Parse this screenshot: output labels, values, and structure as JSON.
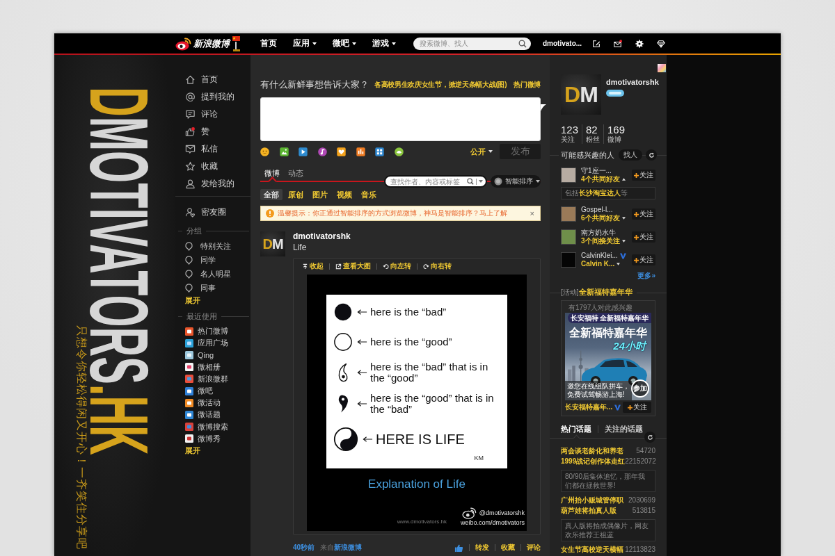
{
  "banner": {
    "logo_parts": [
      {
        "text": "D",
        "kind": "accent"
      },
      {
        "text": "MOTIVATORS",
        "kind": "plain"
      },
      {
        "text": ".HK",
        "kind": "accent"
      }
    ],
    "slogan": "只想令你轻松得闲又开心！一齐笑住分享吧"
  },
  "top_nav": {
    "logo_text": "新浪微博",
    "items": [
      {
        "label": "首页",
        "dropdown": false
      },
      {
        "label": "应用",
        "dropdown": true
      },
      {
        "label": "微吧",
        "dropdown": true
      },
      {
        "label": "游戏",
        "dropdown": true
      }
    ],
    "search": {
      "placeholder": "搜索微博、找人"
    },
    "username": "dmotivato...",
    "mail_unread": true
  },
  "left_nav": {
    "main_items": [
      {
        "label": "首页",
        "unread": false
      },
      {
        "label": "提到我的",
        "unread": false
      },
      {
        "label": "评论",
        "unread": false
      },
      {
        "label": "赞",
        "unread": true
      },
      {
        "label": "私信",
        "unread": false
      },
      {
        "label": "收藏",
        "unread": false
      },
      {
        "label": "发给我的",
        "unread": false
      }
    ],
    "circle_item": {
      "label": "密友圈"
    },
    "groups": {
      "title": "分组",
      "items": [
        {
          "label": "特别关注"
        },
        {
          "label": "同学"
        },
        {
          "label": "名人明星"
        },
        {
          "label": "同事"
        }
      ],
      "more": "展开"
    },
    "recent": {
      "title": "最近使用",
      "items": [
        {
          "label": "热门微博"
        },
        {
          "label": "应用广场"
        },
        {
          "label": "Qing"
        },
        {
          "label": "微相册"
        },
        {
          "label": "新浪微群"
        },
        {
          "label": "微吧"
        },
        {
          "label": "微活动"
        },
        {
          "label": "微话题"
        },
        {
          "label": "微博搜索"
        },
        {
          "label": "微博秀"
        }
      ],
      "more": "展开"
    }
  },
  "composer": {
    "prompt": "有什么新鲜事想告诉大家？",
    "hot_topic": "各高校男生欢庆女生节，掀逆天条幅大战(图)",
    "hot_label": "热门微博",
    "visibility": "公开",
    "submit": "发布"
  },
  "feed": {
    "tabs": [
      {
        "label": "微博",
        "selected": true
      },
      {
        "label": "动态",
        "selected": false
      }
    ],
    "search": {
      "placeholder": "查找作者、内容或标签"
    },
    "sort": "智能排序",
    "filters": [
      {
        "label": "全部",
        "selected": true
      },
      {
        "label": "原创",
        "selected": false
      },
      {
        "label": "图片",
        "selected": false
      },
      {
        "label": "视频",
        "selected": false
      },
      {
        "label": "音乐",
        "selected": false
      }
    ],
    "notice": {
      "text": "温馨提示：你正通过智能排序的方式浏览微博，神马是智能排序？马上了解",
      "close": "×"
    }
  },
  "post": {
    "avatar_text": "DM",
    "author": "dmotivatorshk",
    "text": "Life",
    "media": {
      "actions": [
        {
          "label": "收起"
        },
        {
          "label": "查看大图"
        },
        {
          "label": "向左转"
        },
        {
          "label": "向右转"
        }
      ],
      "card_lines": [
        {
          "kind": "dark",
          "text": "here is the “bad”"
        },
        {
          "kind": "light",
          "text": "here is the “good”"
        },
        {
          "kind": "lightdot",
          "text": "here is the “bad” that is in the “good”"
        },
        {
          "kind": "darkdot",
          "text": "here is the “good” that is in the “bad”"
        },
        {
          "kind": "yinyang",
          "text": "HERE IS LIFE"
        }
      ],
      "signature": "KM",
      "caption": "Explanation of Life",
      "site": "www.dmotivators.hk",
      "handle": "@dmotivatorshk",
      "url": "weibo.com/dmotivators"
    },
    "time": "40秒前",
    "source_prefix": "来自",
    "source": "新浪微博",
    "actions": [
      "转发",
      "收藏",
      "评论"
    ]
  },
  "profile": {
    "avatar_text": "DM",
    "name": "dmotivatorshk",
    "stats": [
      {
        "value": "123",
        "label": "关注"
      },
      {
        "value": "82",
        "label": "粉丝"
      },
      {
        "value": "169",
        "label": "微博"
      }
    ]
  },
  "suggestions": {
    "title": "可能感兴趣的人",
    "find": "找人",
    "people": [
      {
        "name": "守1座一...",
        "verified": false,
        "relation": "4个共同好友",
        "expanded": true,
        "detail": "包括**长沙淘宝达人**等",
        "follow": "关注"
      },
      {
        "name": "Gospel-l...",
        "verified": false,
        "relation": "6个共同好友",
        "expanded": false,
        "follow": "关注"
      },
      {
        "name": "南方奶水牛",
        "verified": false,
        "relation": "3个间接关注",
        "expanded": false,
        "follow": "关注"
      },
      {
        "name": "CalvinKlei...",
        "verified": true,
        "relation": "Calvin K...",
        "expanded": false,
        "follow": "关注"
      }
    ],
    "more": "更多»"
  },
  "activity": {
    "tag": "[活动]",
    "title": "全新福特嘉年华",
    "interest": "有1797人对此感兴趣",
    "banner": {
      "brand_line": "长安福特 全新福特嘉年华",
      "headline": "全新福特嘉年华",
      "subline": "24小时",
      "invite": "邀您在线组队拼车，免费试驾畅游上海!",
      "join": "参加"
    },
    "account": "长安福特嘉年...",
    "verified": true,
    "follow": "关注"
  },
  "topics": {
    "tabs": [
      {
        "label": "热门话题",
        "selected": true
      },
      {
        "label": "关注的话题",
        "selected": false
      }
    ],
    "items": [
      {
        "name": "两会谈老龄化和养老",
        "count": "54720"
      },
      {
        "name": "1999战记创作体走红",
        "count": "22152072",
        "description": "80/90后集体追忆，那年我们都在拯救世界!"
      },
      {
        "name": "广州抬小贩城管停职",
        "count": "2030699"
      },
      {
        "name": "葫芦娃将拍真人版",
        "count": "513815",
        "description": "真人版将拍成偶像片，网友欢乐推荐王祖蓝"
      },
      {
        "name": "女生节高校逆天横幅",
        "count": "12113823"
      }
    ]
  }
}
